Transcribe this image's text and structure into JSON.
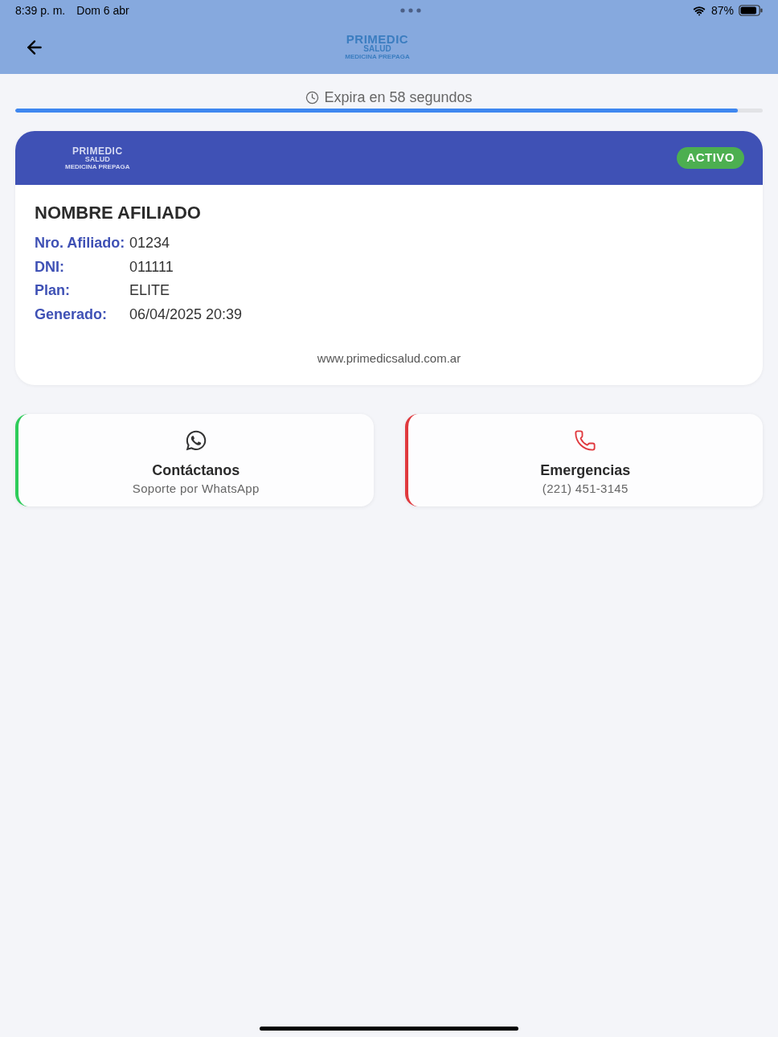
{
  "status_bar": {
    "time": "8:39 p. m.",
    "date": "Dom 6 abr",
    "battery": "87%"
  },
  "header": {
    "logo": {
      "line_1": "PRIMEDIC",
      "line_2": "SALUD",
      "tagline": "MEDICINA PREPAGA"
    }
  },
  "timer": {
    "text": "Expira en 58 segundos",
    "level": 0.967
  },
  "card": {
    "logo": {
      "line_1": "PRIMEDIC",
      "line_2": "SALUD",
      "tagline": "MEDICINA PREPAGA"
    },
    "status": "ACTIVO",
    "name": "NOMBRE AFILIADO",
    "fields": [
      {
        "label": "Nro. Afiliado:",
        "value": "01234"
      },
      {
        "label": "DNI:",
        "value": "011111"
      },
      {
        "label": "Plan:",
        "value": "ELITE"
      },
      {
        "label": "Generado:",
        "value": "06/04/2025 20:39"
      }
    ],
    "website": "www.primedicsalud.com.ar"
  },
  "contacts": [
    {
      "kind": "whatsapp",
      "title": "Contáctanos",
      "subtitle": "Soporte por WhatsApp",
      "color": "#2ecc5a"
    },
    {
      "kind": "phone",
      "title": "Emergencias",
      "subtitle": "(221) 451-3145",
      "color": "#e0393e"
    }
  ]
}
